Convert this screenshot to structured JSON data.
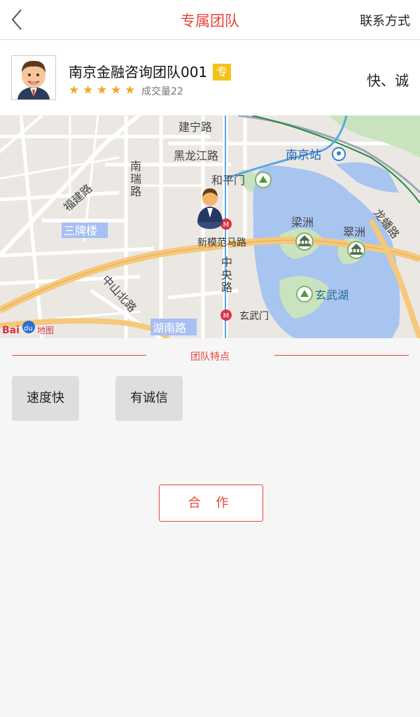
{
  "header": {
    "title": "专属团队",
    "contact_label": "联系方式"
  },
  "team": {
    "name": "南京金融咨询团队001",
    "badge": "专",
    "rating": 5,
    "deals_label": "成交量22",
    "traits": "快、诚"
  },
  "map": {
    "labels": {
      "road1": "建宁路",
      "road2": "黑龙江路",
      "road3": "南",
      "road3b": "瑞",
      "road3c": "路",
      "road4": "福建路",
      "station": "南京站",
      "heping": "和平门",
      "sanpailou": "三牌楼",
      "liangzhou": "梁洲",
      "cuizhou": "翠洲",
      "longpan": "龙蟠路",
      "xinmofan": "新模范马路",
      "zhongyang": "中",
      "zhongyang2": "央",
      "zhongyang3": "路",
      "xuanwuhu": "玄武湖",
      "zhongshanbei": "中山北路",
      "hunan": "湖南路",
      "xuanwumen": "玄武门",
      "logo": "Bai",
      "logo2": "du",
      "logo3": "地图"
    },
    "colors": {
      "land": "#ebe8e3",
      "water": "#a8c5f0",
      "park": "#c9e3be",
      "major_road": "#f6c87a",
      "road": "#ffffff",
      "metro": "#5aa8e6"
    }
  },
  "features": {
    "title": "团队特点",
    "tags": [
      "速度快",
      "有诚信"
    ]
  },
  "cooperate_label": "合 作"
}
